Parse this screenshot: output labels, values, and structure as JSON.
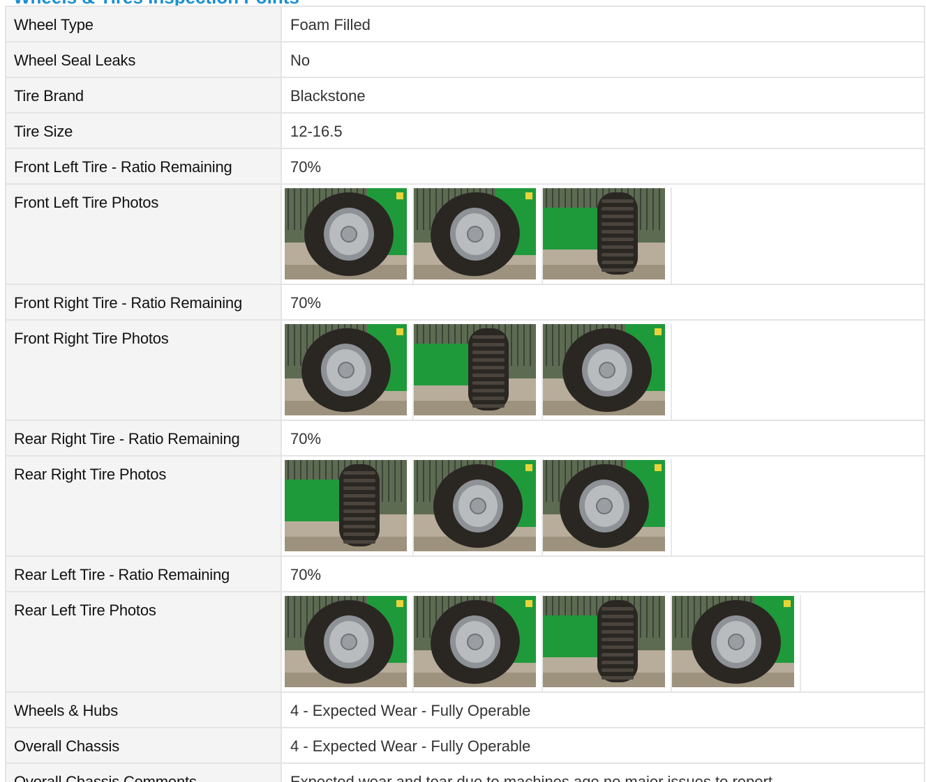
{
  "section": {
    "title": "Wheels & Tires Inspection Points"
  },
  "rows": [
    {
      "label": "Wheel Type",
      "value": "Foam Filled"
    },
    {
      "label": "Wheel Seal Leaks",
      "value": "No"
    },
    {
      "label": "Tire Brand",
      "value": "Blackstone"
    },
    {
      "label": "Tire Size",
      "value": "12-16.5"
    },
    {
      "label": "Front Left Tire - Ratio Remaining",
      "value": "70%"
    },
    {
      "label": "Front Left Tire Photos"
    },
    {
      "label": "Front Right Tire - Ratio Remaining",
      "value": "70%"
    },
    {
      "label": "Front Right Tire Photos"
    },
    {
      "label": "Rear Right Tire - Ratio Remaining",
      "value": "70%"
    },
    {
      "label": "Rear Right Tire Photos"
    },
    {
      "label": "Rear Left Tire - Ratio Remaining",
      "value": "70%"
    },
    {
      "label": "Rear Left Tire Photos"
    },
    {
      "label": "Wheels & Hubs",
      "value": "4 - Expected Wear - Fully Operable"
    },
    {
      "label": "Overall Chassis",
      "value": "4 - Expected Wear - Fully Operable"
    },
    {
      "label": "Overall Chassis Comments",
      "value": "Expected wear and tear due to machines age no major issues to report"
    }
  ],
  "colors": {
    "title": "#1a8fd1",
    "label_bg": "#f4f4f4",
    "border": "#e4e4e4",
    "machine_green": "#1f9a3a",
    "tire": "#2a2723",
    "ground": "#b7ad9a"
  }
}
